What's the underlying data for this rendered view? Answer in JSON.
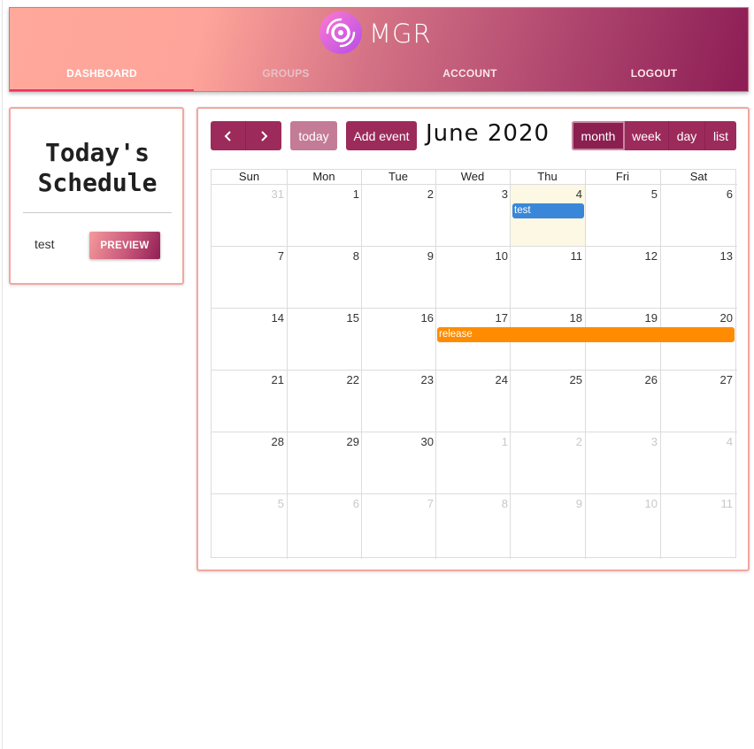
{
  "brand": {
    "name": "MGR"
  },
  "nav": {
    "items": [
      "DASHBOARD",
      "GROUPS",
      "ACCOUNT",
      "LOGOUT"
    ],
    "active": "DASHBOARD"
  },
  "schedule": {
    "title_line1": "Today's",
    "title_line2": "Schedule",
    "items": [
      {
        "name": "test",
        "button": "PREVIEW"
      }
    ]
  },
  "calendar": {
    "toolbar": {
      "prev_icon": "chevron-left-icon",
      "next_icon": "chevron-right-icon",
      "today": "today",
      "add_event": "Add event",
      "title": "June 2020",
      "views": [
        "month",
        "week",
        "day",
        "list"
      ],
      "active_view": "month"
    },
    "weekdays": [
      "Sun",
      "Mon",
      "Tue",
      "Wed",
      "Thu",
      "Fri",
      "Sat"
    ],
    "weeks": [
      [
        "31",
        "1",
        "2",
        "3",
        "4",
        "5",
        "6"
      ],
      [
        "7",
        "8",
        "9",
        "10",
        "11",
        "12",
        "13"
      ],
      [
        "14",
        "15",
        "16",
        "17",
        "18",
        "19",
        "20"
      ],
      [
        "21",
        "22",
        "23",
        "24",
        "25",
        "26",
        "27"
      ],
      [
        "28",
        "29",
        "30",
        "1",
        "2",
        "3",
        "4"
      ],
      [
        "5",
        "6",
        "7",
        "8",
        "9",
        "10",
        "11"
      ]
    ],
    "today": "4",
    "events": [
      {
        "title": "test",
        "color": "#3a87d9",
        "start": "2020-06-04",
        "end": "2020-06-04"
      },
      {
        "title": "release",
        "color": "#ff8c00",
        "start": "2020-06-17",
        "end": "2020-06-20"
      }
    ]
  },
  "colors": {
    "accent": "#9c2b5c",
    "today_bg": "#fcf8e3",
    "card_border": "#f4a6a0"
  }
}
